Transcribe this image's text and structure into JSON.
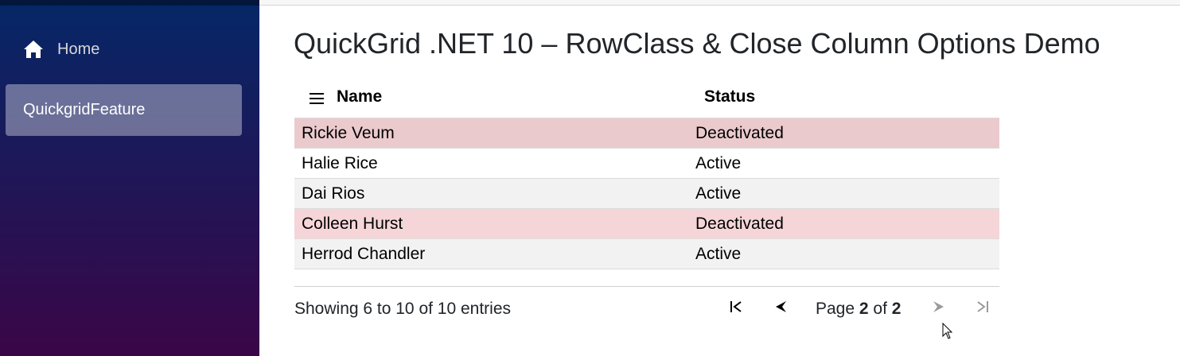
{
  "sidebar": {
    "items": [
      {
        "label": "Home",
        "icon": "home-icon"
      },
      {
        "label": "QuickgridFeature",
        "active": true
      }
    ]
  },
  "main": {
    "title": "QuickGrid .NET 10 – RowClass & Close Column Options Demo"
  },
  "grid": {
    "columns": [
      {
        "label": "Name",
        "icon": "menu-icon"
      },
      {
        "label": "Status"
      }
    ],
    "rows": [
      {
        "name": "Rickie Veum",
        "status": "Deactivated"
      },
      {
        "name": "Halie Rice",
        "status": "Active"
      },
      {
        "name": "Dai Rios",
        "status": "Active"
      },
      {
        "name": "Colleen Hurst",
        "status": "Deactivated"
      },
      {
        "name": "Herrod Chandler",
        "status": "Active"
      }
    ],
    "colors": {
      "deactivated_row": "#ebcacd",
      "deactivated_row_alt": "#f5d5d8",
      "stripe_row": "#f2f2f2"
    }
  },
  "pagination": {
    "summary": "Showing 6 to 10 of 10 entries",
    "page_prefix": "Page",
    "current_page": "2",
    "of_label": "of",
    "total_pages": "2"
  },
  "theme": {
    "sidebar_gradient_start": "#052767",
    "sidebar_gradient_end": "#3a0647"
  }
}
